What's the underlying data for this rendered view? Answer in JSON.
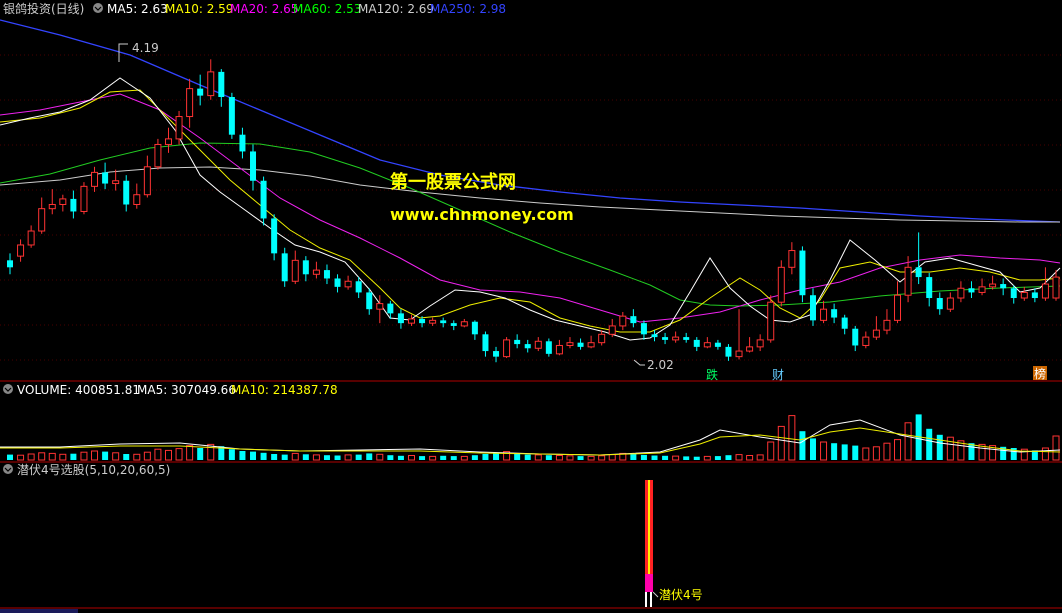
{
  "price_panel": {
    "title": "银鸽投资(日线)",
    "indicators": [
      {
        "label": "MA5: 2.63",
        "color": "#ffffff"
      },
      {
        "label": "MA10: 2.59",
        "color": "#ffff00"
      },
      {
        "label": "MA20: 2.65",
        "color": "#ff00ff"
      },
      {
        "label": "MA60: 2.53",
        "color": "#00ff00"
      },
      {
        "label": "MA120: 2.69",
        "color": "#cccccc"
      },
      {
        "label": "MA250: 2.98",
        "color": "#3333ff"
      }
    ],
    "high_label": "4.19",
    "low_label": "2.02",
    "event_markers": [
      {
        "text": "跌",
        "color": "#00ff66"
      },
      {
        "text": "财",
        "color": "#66ccff"
      },
      {
        "text": "榜",
        "color": "#ff6600"
      }
    ]
  },
  "watermark": {
    "line1": "第一股票公式网",
    "line2": "www.chnmoney.com",
    "color": "#ffff00"
  },
  "volume_panel": {
    "labels": [
      {
        "label": "VOLUME: 400851.81",
        "color": "#ffffff"
      },
      {
        "label": "MA5: 307049.66",
        "color": "#ffffff"
      },
      {
        "label": "MA10: 214387.78",
        "color": "#ffff00"
      }
    ]
  },
  "indicator_panel": {
    "title": "潜伏4号选股(5,10,20,60,5)",
    "signal_label": "潜伏4号"
  },
  "chart_data": {
    "type": "candlestick",
    "ylim": [
      1.95,
      4.4
    ],
    "volume_ylim": [
      0,
      1000
    ],
    "candles": [
      [
        2.75,
        2.7,
        2.8,
        2.65
      ],
      [
        2.78,
        2.86,
        2.9,
        2.74
      ],
      [
        2.86,
        2.96,
        3.0,
        2.84
      ],
      [
        2.96,
        3.12,
        3.2,
        2.94
      ],
      [
        3.12,
        3.15,
        3.26,
        3.08
      ],
      [
        3.15,
        3.19,
        3.22,
        3.1
      ],
      [
        3.19,
        3.1,
        3.25,
        3.05
      ],
      [
        3.1,
        3.28,
        3.31,
        3.08
      ],
      [
        3.28,
        3.38,
        3.42,
        3.24
      ],
      [
        3.38,
        3.3,
        3.45,
        3.26
      ],
      [
        3.3,
        3.32,
        3.4,
        3.25
      ],
      [
        3.32,
        3.15,
        3.36,
        3.1
      ],
      [
        3.15,
        3.22,
        3.3,
        3.12
      ],
      [
        3.22,
        3.42,
        3.5,
        3.2
      ],
      [
        3.42,
        3.58,
        3.62,
        3.4
      ],
      [
        3.58,
        3.62,
        3.7,
        3.52
      ],
      [
        3.62,
        3.78,
        3.82,
        3.58
      ],
      [
        3.78,
        3.98,
        4.05,
        3.7
      ],
      [
        3.98,
        3.93,
        4.08,
        3.86
      ],
      [
        3.93,
        4.1,
        4.19,
        3.9
      ],
      [
        4.1,
        3.92,
        4.12,
        3.85
      ],
      [
        3.92,
        3.65,
        3.95,
        3.62
      ],
      [
        3.65,
        3.53,
        3.7,
        3.48
      ],
      [
        3.53,
        3.32,
        3.58,
        3.25
      ],
      [
        3.32,
        3.05,
        3.35,
        3.0
      ],
      [
        3.05,
        2.8,
        3.08,
        2.75
      ],
      [
        2.8,
        2.6,
        2.84,
        2.56
      ],
      [
        2.6,
        2.75,
        2.82,
        2.58
      ],
      [
        2.75,
        2.65,
        2.78,
        2.6
      ],
      [
        2.65,
        2.68,
        2.74,
        2.62
      ],
      [
        2.68,
        2.62,
        2.72,
        2.58
      ],
      [
        2.62,
        2.56,
        2.65,
        2.52
      ],
      [
        2.56,
        2.6,
        2.64,
        2.54
      ],
      [
        2.6,
        2.52,
        2.63,
        2.48
      ],
      [
        2.52,
        2.4,
        2.55,
        2.36
      ],
      [
        2.4,
        2.44,
        2.5,
        2.3
      ],
      [
        2.44,
        2.37,
        2.46,
        2.33
      ],
      [
        2.37,
        2.3,
        2.4,
        2.26
      ],
      [
        2.3,
        2.33,
        2.36,
        2.28
      ],
      [
        2.33,
        2.3,
        2.35,
        2.27
      ],
      [
        2.3,
        2.32,
        2.34,
        2.28
      ],
      [
        2.32,
        2.3,
        2.34,
        2.27
      ],
      [
        2.3,
        2.28,
        2.32,
        2.25
      ],
      [
        2.28,
        2.31,
        2.33,
        2.27
      ],
      [
        2.31,
        2.22,
        2.32,
        2.18
      ],
      [
        2.22,
        2.1,
        2.24,
        2.06
      ],
      [
        2.1,
        2.06,
        2.13,
        2.02
      ],
      [
        2.06,
        2.18,
        2.2,
        2.05
      ],
      [
        2.18,
        2.15,
        2.22,
        2.12
      ],
      [
        2.15,
        2.12,
        2.18,
        2.09
      ],
      [
        2.12,
        2.17,
        2.2,
        2.1
      ],
      [
        2.17,
        2.08,
        2.19,
        2.06
      ],
      [
        2.08,
        2.14,
        2.18,
        2.07
      ],
      [
        2.14,
        2.16,
        2.2,
        2.12
      ],
      [
        2.16,
        2.13,
        2.19,
        2.11
      ],
      [
        2.13,
        2.16,
        2.21,
        2.12
      ],
      [
        2.16,
        2.22,
        2.25,
        2.14
      ],
      [
        2.22,
        2.28,
        2.33,
        2.2
      ],
      [
        2.28,
        2.35,
        2.38,
        2.25
      ],
      [
        2.35,
        2.3,
        2.4,
        2.27
      ],
      [
        2.3,
        2.22,
        2.32,
        2.18
      ],
      [
        2.22,
        2.2,
        2.25,
        2.17
      ],
      [
        2.2,
        2.18,
        2.23,
        2.15
      ],
      [
        2.18,
        2.2,
        2.24,
        2.16
      ],
      [
        2.2,
        2.18,
        2.23,
        2.16
      ],
      [
        2.18,
        2.13,
        2.2,
        2.1
      ],
      [
        2.13,
        2.16,
        2.2,
        2.12
      ],
      [
        2.16,
        2.13,
        2.18,
        2.11
      ],
      [
        2.13,
        2.06,
        2.15,
        2.03
      ],
      [
        2.06,
        2.1,
        2.4,
        2.04
      ],
      [
        2.1,
        2.13,
        2.2,
        2.09
      ],
      [
        2.13,
        2.18,
        2.22,
        2.1
      ],
      [
        2.18,
        2.45,
        2.5,
        2.16
      ],
      [
        2.45,
        2.7,
        2.75,
        2.42
      ],
      [
        2.7,
        2.82,
        2.88,
        2.65
      ],
      [
        2.82,
        2.5,
        2.85,
        2.45
      ],
      [
        2.5,
        2.32,
        2.55,
        2.28
      ],
      [
        2.32,
        2.4,
        2.46,
        2.3
      ],
      [
        2.4,
        2.34,
        2.44,
        2.3
      ],
      [
        2.34,
        2.26,
        2.36,
        2.22
      ],
      [
        2.26,
        2.14,
        2.28,
        2.1
      ],
      [
        2.14,
        2.2,
        2.24,
        2.12
      ],
      [
        2.2,
        2.25,
        2.35,
        2.18
      ],
      [
        2.25,
        2.32,
        2.4,
        2.22
      ],
      [
        2.32,
        2.5,
        2.6,
        2.3
      ],
      [
        2.5,
        2.7,
        2.78,
        2.45
      ],
      [
        2.7,
        2.63,
        2.95,
        2.58
      ],
      [
        2.63,
        2.48,
        2.66,
        2.42
      ],
      [
        2.48,
        2.4,
        2.52,
        2.36
      ],
      [
        2.4,
        2.48,
        2.52,
        2.38
      ],
      [
        2.48,
        2.55,
        2.6,
        2.45
      ],
      [
        2.55,
        2.52,
        2.6,
        2.48
      ],
      [
        2.52,
        2.56,
        2.62,
        2.5
      ],
      [
        2.56,
        2.58,
        2.64,
        2.54
      ],
      [
        2.58,
        2.55,
        2.62,
        2.5
      ],
      [
        2.55,
        2.48,
        2.57,
        2.44
      ],
      [
        2.48,
        2.52,
        2.56,
        2.46
      ],
      [
        2.52,
        2.48,
        2.55,
        2.45
      ],
      [
        2.48,
        2.58,
        2.7,
        2.46
      ],
      [
        2.48,
        2.63,
        2.68,
        2.46
      ]
    ],
    "volume": [
      90,
      80,
      100,
      120,
      110,
      95,
      105,
      130,
      150,
      140,
      120,
      100,
      95,
      130,
      180,
      160,
      190,
      240,
      200,
      260,
      230,
      180,
      150,
      140,
      120,
      100,
      90,
      110,
      95,
      85,
      80,
      75,
      85,
      90,
      110,
      95,
      80,
      70,
      75,
      65,
      60,
      70,
      65,
      60,
      80,
      100,
      120,
      140,
      110,
      90,
      85,
      80,
      75,
      70,
      65,
      60,
      70,
      90,
      110,
      100,
      85,
      75,
      70,
      65,
      60,
      55,
      60,
      65,
      80,
      90,
      75,
      85,
      300,
      560,
      740,
      480,
      360,
      300,
      280,
      260,
      240,
      200,
      220,
      280,
      340,
      620,
      760,
      520,
      420,
      380,
      320,
      280,
      260,
      240,
      220,
      200,
      180,
      160,
      200,
      400
    ]
  }
}
